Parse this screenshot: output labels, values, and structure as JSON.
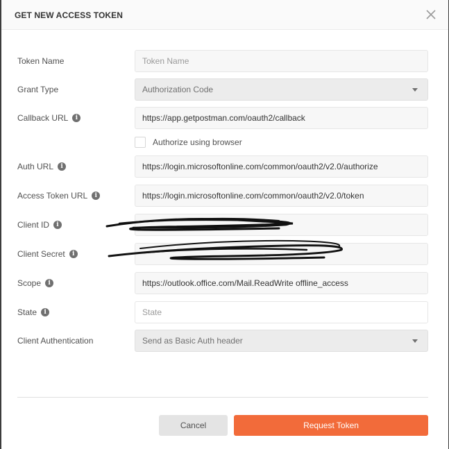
{
  "modal": {
    "title": "GET NEW ACCESS TOKEN",
    "close_icon": "close-x-icon"
  },
  "fields": {
    "token_name": {
      "label": "Token Name",
      "value": "",
      "placeholder": "Token Name"
    },
    "grant_type": {
      "label": "Grant Type",
      "selected": "Authorization Code"
    },
    "callback_url": {
      "label": "Callback URL",
      "value": "https://app.getpostman.com/oauth2/callback"
    },
    "authorize_browser": {
      "label": "Authorize using browser",
      "checked": false
    },
    "auth_url": {
      "label": "Auth URL",
      "value": "https://login.microsoftonline.com/common/oauth2/v2.0/authorize"
    },
    "access_token_url": {
      "label": "Access Token URL",
      "value": "https://login.microsoftonline.com/common/oauth2/v2.0/token"
    },
    "client_id": {
      "label": "Client ID",
      "value": ""
    },
    "client_secret": {
      "label": "Client Secret",
      "value": ""
    },
    "scope": {
      "label": "Scope",
      "value": "https://outlook.office.com/Mail.ReadWrite offline_access"
    },
    "state": {
      "label": "State",
      "value": "",
      "placeholder": "State"
    },
    "client_auth": {
      "label": "Client Authentication",
      "selected": "Send as Basic Auth header"
    }
  },
  "buttons": {
    "cancel": "Cancel",
    "request_token": "Request Token"
  },
  "colors": {
    "primary": "#f26b3a",
    "overlay": "#3c3c3c"
  }
}
